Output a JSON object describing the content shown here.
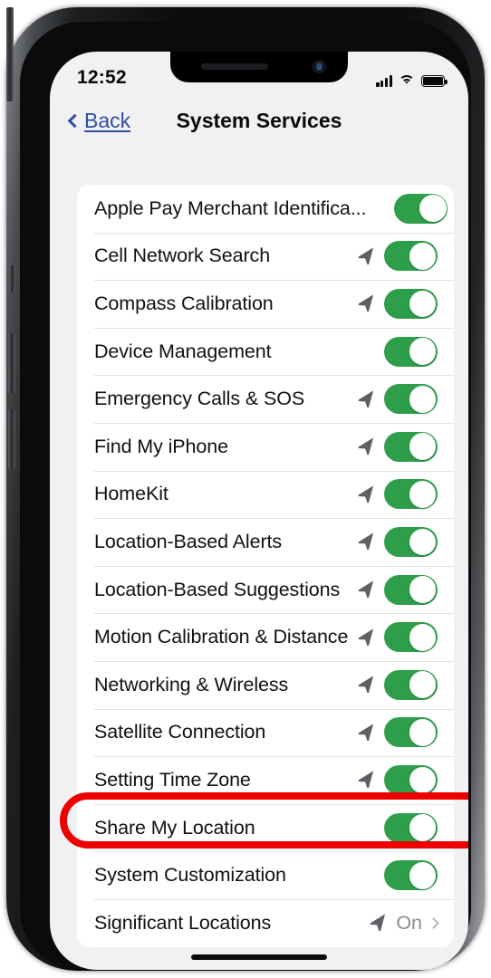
{
  "status_bar": {
    "time": "12:52",
    "signal_icon": "cellular-bars-icon",
    "wifi_icon": "wifi-icon",
    "battery_icon": "battery-icon"
  },
  "nav": {
    "back_label": "Back",
    "back_icon": "chevron-left-icon",
    "title": "System Services"
  },
  "colors": {
    "toggle_on": "#2e9e4a",
    "link": "#2f4fa2",
    "annotation": "#ee0000"
  },
  "rows": [
    {
      "label": "Apple Pay Merchant Identifica...",
      "arrow": false,
      "control": "toggle",
      "on": true
    },
    {
      "label": "Cell Network Search",
      "arrow": true,
      "control": "toggle",
      "on": true
    },
    {
      "label": "Compass Calibration",
      "arrow": true,
      "control": "toggle",
      "on": true
    },
    {
      "label": "Device Management",
      "arrow": false,
      "control": "toggle",
      "on": true
    },
    {
      "label": "Emergency Calls & SOS",
      "arrow": true,
      "control": "toggle",
      "on": true
    },
    {
      "label": "Find My iPhone",
      "arrow": true,
      "control": "toggle",
      "on": true
    },
    {
      "label": "HomeKit",
      "arrow": true,
      "control": "toggle",
      "on": true
    },
    {
      "label": "Location-Based Alerts",
      "arrow": true,
      "control": "toggle",
      "on": true
    },
    {
      "label": "Location-Based Suggestions",
      "arrow": true,
      "control": "toggle",
      "on": true
    },
    {
      "label": "Motion Calibration & Distance",
      "arrow": true,
      "control": "toggle",
      "on": true
    },
    {
      "label": "Networking & Wireless",
      "arrow": true,
      "control": "toggle",
      "on": true
    },
    {
      "label": "Satellite Connection",
      "arrow": true,
      "control": "toggle",
      "on": true
    },
    {
      "label": "Setting Time Zone",
      "arrow": true,
      "control": "toggle",
      "on": true,
      "highlighted": true
    },
    {
      "label": "Share My Location",
      "arrow": false,
      "control": "toggle",
      "on": true
    },
    {
      "label": "System Customization",
      "arrow": false,
      "control": "toggle",
      "on": true
    },
    {
      "label": "Significant Locations",
      "arrow": true,
      "control": "disclosure",
      "value": "On"
    }
  ]
}
